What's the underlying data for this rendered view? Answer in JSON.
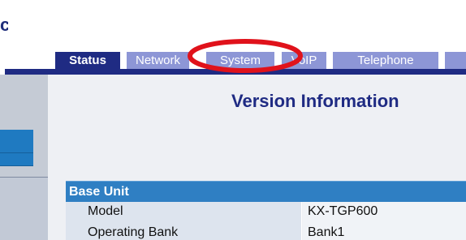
{
  "brand": {
    "fragment": "c"
  },
  "tabs": [
    {
      "label": "Status",
      "active": true
    },
    {
      "label": "Network",
      "active": false
    },
    {
      "label": "System",
      "active": false
    },
    {
      "label": "VoIP",
      "active": false
    },
    {
      "label": "Telephone",
      "active": false
    },
    {
      "label": "",
      "active": false
    }
  ],
  "page": {
    "title": "Version Information"
  },
  "section": {
    "title": "Base Unit",
    "rows": [
      {
        "label": "Model",
        "value": "KX-TGP600"
      },
      {
        "label": "Operating Bank",
        "value": "Bank1"
      }
    ]
  },
  "colors": {
    "nav_dark": "#1f2b83",
    "tab_light": "#8d96d6",
    "section_blue": "#2f7fc3",
    "highlight_red": "#e0121b"
  },
  "annotation": {
    "target": "System",
    "shape": "ellipse"
  }
}
